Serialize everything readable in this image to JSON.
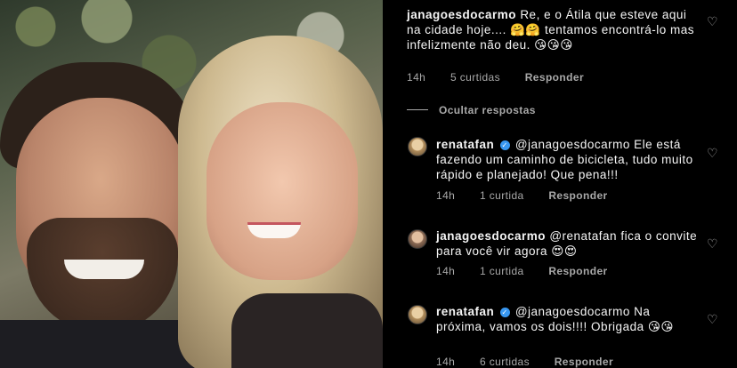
{
  "comments": [
    {
      "user": "janagoesdocarmo",
      "text": "Re, e o Átila que esteve aqui na cidade hoje.... 🤗🤗 tentamos encontrá-lo mas infelizmente não deu. 😘😘😘",
      "time": "14h",
      "likes": "5 curtidas",
      "reply": "Responder"
    },
    {
      "user": "renatafan",
      "verified": true,
      "mention": "@janagoesdocarmo",
      "text": "Ele está fazendo um caminho de bicicleta, tudo muito rápido e planejado! Que pena!!!",
      "time": "14h",
      "likes": "1 curtida",
      "reply": "Responder"
    },
    {
      "user": "janagoesdocarmo",
      "mention": "@renatafan",
      "text": "fica o convite para você vir agora 😍😍",
      "time": "14h",
      "likes": "1 curtida",
      "reply": "Responder"
    },
    {
      "user": "renatafan",
      "verified": true,
      "mention": "@janagoesdocarmo",
      "text": "Na próxima, vamos os dois!!!! Obrigada 😘😘",
      "time": "14h",
      "likes": "6 curtidas",
      "reply": "Responder"
    }
  ],
  "hide_replies": "Ocultar respostas",
  "icons": {
    "heart": "heart-outline-icon",
    "verified": "verified-badge-icon"
  },
  "colors": {
    "background": "#000000",
    "text": "#f5f5f5",
    "meta": "#a8a8a8",
    "verified": "#3897f0"
  }
}
